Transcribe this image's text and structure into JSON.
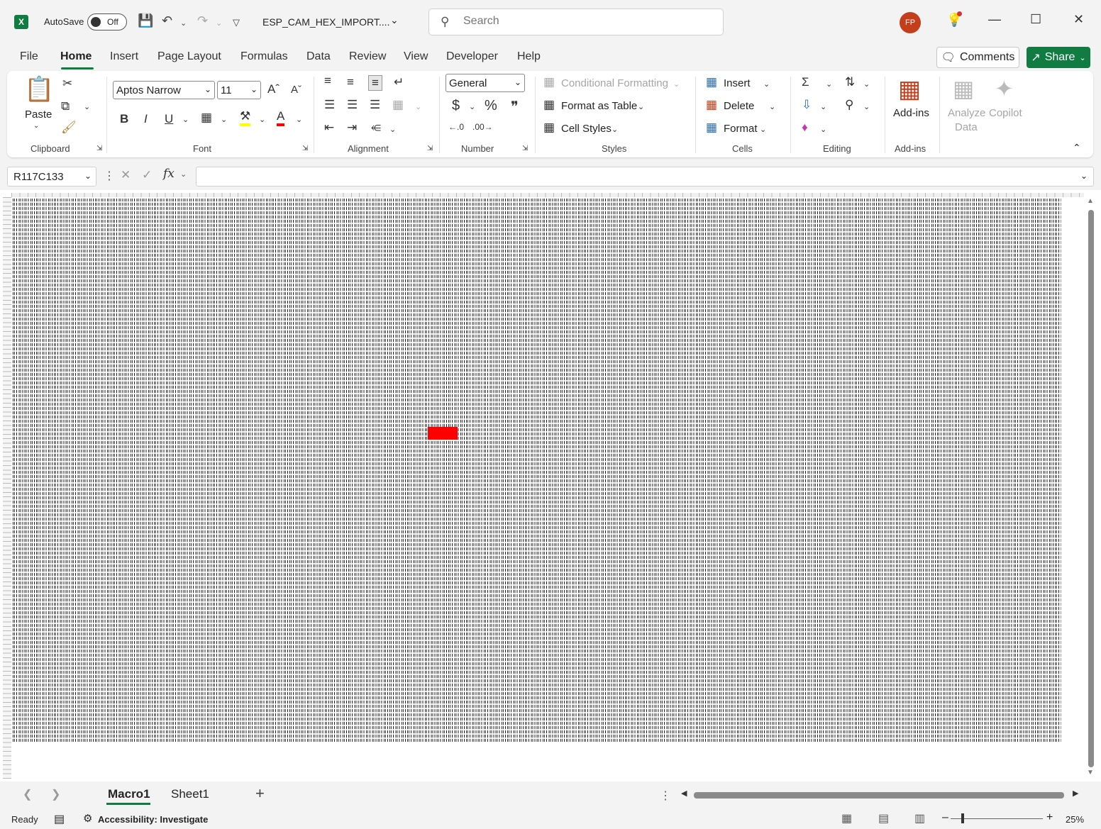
{
  "titlebar": {
    "app_logo": "X",
    "autosave_label": "AutoSave",
    "autosave_state": "Off",
    "doc_title": "ESP_CAM_HEX_IMPORT....",
    "search_placeholder": "Search",
    "avatar_initials": "FP"
  },
  "tabs": {
    "file": "File",
    "home": "Home",
    "insert": "Insert",
    "page_layout": "Page Layout",
    "formulas": "Formulas",
    "data": "Data",
    "review": "Review",
    "view": "View",
    "developer": "Developer",
    "help": "Help",
    "comments": "Comments",
    "share": "Share"
  },
  "ribbon": {
    "paste": "Paste",
    "font_name": "Aptos Narrow",
    "font_size": "11",
    "number_format": "General",
    "conditional_formatting": "Conditional Formatting",
    "format_as_table": "Format as Table",
    "cell_styles": "Cell Styles",
    "insert": "Insert",
    "delete": "Delete",
    "format": "Format",
    "add_ins": "Add-ins",
    "analyze_data_1": "Analyze",
    "analyze_data_2": "Data",
    "copilot": "Copilot",
    "groups": {
      "clipboard": "Clipboard",
      "font": "Font",
      "alignment": "Alignment",
      "number": "Number",
      "styles": "Styles",
      "cells": "Cells",
      "editing": "Editing",
      "addins": "Add-ins"
    },
    "bold": "B",
    "italic": "I",
    "underline": "U",
    "font_color_glyph": "A"
  },
  "formula_bar": {
    "name_box": "R117C133",
    "formula": ""
  },
  "sheets": {
    "active": "Macro1",
    "other": "Sheet1"
  },
  "statusbar": {
    "ready": "Ready",
    "accessibility": "Accessibility: Investigate",
    "zoom": "25%"
  },
  "colors": {
    "excel_green": "#107c41",
    "highlight_red": "#ff0000",
    "avatar": "#c43e1c"
  }
}
